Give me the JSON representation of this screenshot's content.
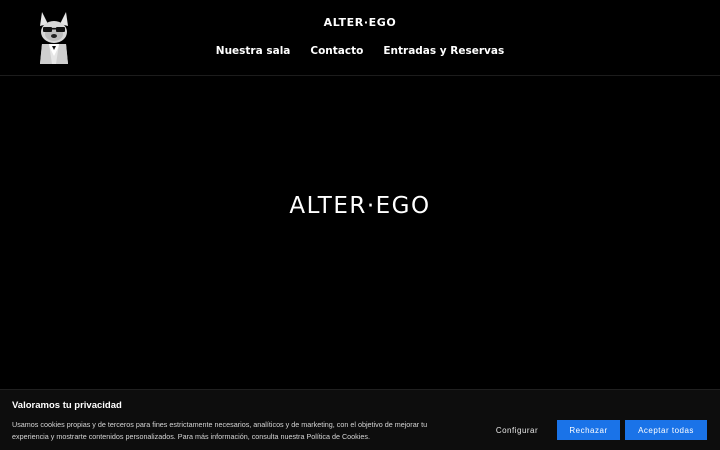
{
  "header": {
    "brand": "ALTER·EGO",
    "nav": [
      {
        "label": "Nuestra sala"
      },
      {
        "label": "Contacto"
      },
      {
        "label": "Entradas y Reservas"
      }
    ]
  },
  "hero": {
    "brand": "ALTER·EGO"
  },
  "cookie_banner": {
    "title": "Valoramos tu privacidad",
    "text": "Usamos cookies propias y de terceros para fines estrictamente necesarios, analíticos y de marketing, con el objetivo de mejorar tu experiencia y mostrarte contenidos personalizados. Para más información, consulta nuestra Política de Cookies.",
    "buttons": {
      "configure": "Configurar",
      "reject": "Rechazar",
      "accept": "Aceptar todas"
    }
  },
  "colors": {
    "background": "#000000",
    "accent": "#1a73e8",
    "text": "#ffffff"
  },
  "icons": {
    "logo": "french-bulldog-suit-icon"
  }
}
